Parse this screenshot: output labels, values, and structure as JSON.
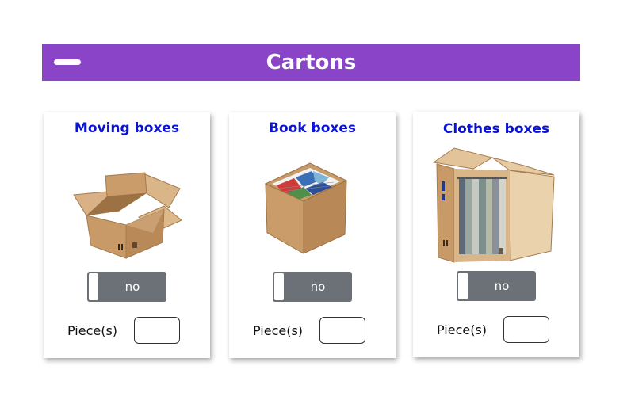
{
  "header": {
    "title": "Cartons",
    "collapse_icon": "minus-icon",
    "color": "#8a44c7"
  },
  "cards": [
    {
      "title": "Moving boxes",
      "illustration": "open-cardboard-box-image",
      "toggle_label": "no",
      "pieces_label": "Piece(s)",
      "quantity": ""
    },
    {
      "title": "Book boxes",
      "illustration": "box-with-books-image",
      "toggle_label": "no",
      "pieces_label": "Piece(s)",
      "quantity": ""
    },
    {
      "title": "Clothes boxes",
      "illustration": "wardrobe-box-image",
      "toggle_label": "no",
      "pieces_label": "Piece(s)",
      "quantity": ""
    }
  ],
  "colors": {
    "card_title": "#0a12d6",
    "toggle_off": "#6c7178"
  }
}
